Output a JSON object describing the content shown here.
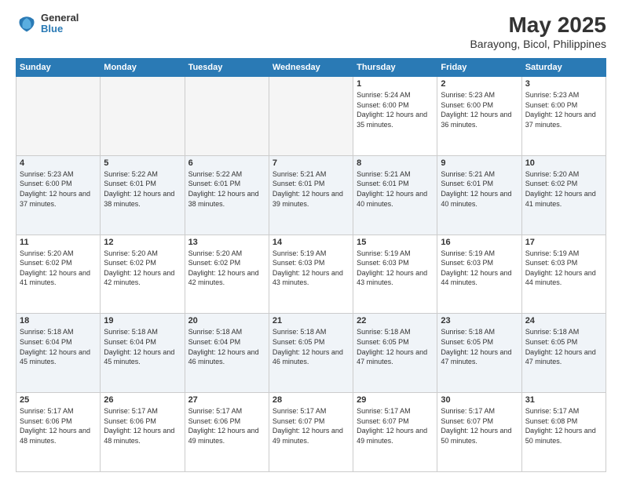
{
  "header": {
    "logo": {
      "line1": "General",
      "line2": "Blue"
    },
    "title": "May 2025",
    "subtitle": "Barayong, Bicol, Philippines"
  },
  "weekdays": [
    "Sunday",
    "Monday",
    "Tuesday",
    "Wednesday",
    "Thursday",
    "Friday",
    "Saturday"
  ],
  "weeks": [
    [
      {
        "day": "",
        "empty": true
      },
      {
        "day": "",
        "empty": true
      },
      {
        "day": "",
        "empty": true
      },
      {
        "day": "",
        "empty": true
      },
      {
        "day": "1",
        "rise": "5:24 AM",
        "set": "6:00 PM",
        "daylight": "12 hours and 35 minutes."
      },
      {
        "day": "2",
        "rise": "5:23 AM",
        "set": "6:00 PM",
        "daylight": "12 hours and 36 minutes."
      },
      {
        "day": "3",
        "rise": "5:23 AM",
        "set": "6:00 PM",
        "daylight": "12 hours and 37 minutes."
      }
    ],
    [
      {
        "day": "4",
        "rise": "5:23 AM",
        "set": "6:00 PM",
        "daylight": "12 hours and 37 minutes."
      },
      {
        "day": "5",
        "rise": "5:22 AM",
        "set": "6:01 PM",
        "daylight": "12 hours and 38 minutes."
      },
      {
        "day": "6",
        "rise": "5:22 AM",
        "set": "6:01 PM",
        "daylight": "12 hours and 38 minutes."
      },
      {
        "day": "7",
        "rise": "5:21 AM",
        "set": "6:01 PM",
        "daylight": "12 hours and 39 minutes."
      },
      {
        "day": "8",
        "rise": "5:21 AM",
        "set": "6:01 PM",
        "daylight": "12 hours and 40 minutes."
      },
      {
        "day": "9",
        "rise": "5:21 AM",
        "set": "6:01 PM",
        "daylight": "12 hours and 40 minutes."
      },
      {
        "day": "10",
        "rise": "5:20 AM",
        "set": "6:02 PM",
        "daylight": "12 hours and 41 minutes."
      }
    ],
    [
      {
        "day": "11",
        "rise": "5:20 AM",
        "set": "6:02 PM",
        "daylight": "12 hours and 41 minutes."
      },
      {
        "day": "12",
        "rise": "5:20 AM",
        "set": "6:02 PM",
        "daylight": "12 hours and 42 minutes."
      },
      {
        "day": "13",
        "rise": "5:20 AM",
        "set": "6:02 PM",
        "daylight": "12 hours and 42 minutes."
      },
      {
        "day": "14",
        "rise": "5:19 AM",
        "set": "6:03 PM",
        "daylight": "12 hours and 43 minutes."
      },
      {
        "day": "15",
        "rise": "5:19 AM",
        "set": "6:03 PM",
        "daylight": "12 hours and 43 minutes."
      },
      {
        "day": "16",
        "rise": "5:19 AM",
        "set": "6:03 PM",
        "daylight": "12 hours and 44 minutes."
      },
      {
        "day": "17",
        "rise": "5:19 AM",
        "set": "6:03 PM",
        "daylight": "12 hours and 44 minutes."
      }
    ],
    [
      {
        "day": "18",
        "rise": "5:18 AM",
        "set": "6:04 PM",
        "daylight": "12 hours and 45 minutes."
      },
      {
        "day": "19",
        "rise": "5:18 AM",
        "set": "6:04 PM",
        "daylight": "12 hours and 45 minutes."
      },
      {
        "day": "20",
        "rise": "5:18 AM",
        "set": "6:04 PM",
        "daylight": "12 hours and 46 minutes."
      },
      {
        "day": "21",
        "rise": "5:18 AM",
        "set": "6:05 PM",
        "daylight": "12 hours and 46 minutes."
      },
      {
        "day": "22",
        "rise": "5:18 AM",
        "set": "6:05 PM",
        "daylight": "12 hours and 47 minutes."
      },
      {
        "day": "23",
        "rise": "5:18 AM",
        "set": "6:05 PM",
        "daylight": "12 hours and 47 minutes."
      },
      {
        "day": "24",
        "rise": "5:18 AM",
        "set": "6:05 PM",
        "daylight": "12 hours and 47 minutes."
      }
    ],
    [
      {
        "day": "25",
        "rise": "5:17 AM",
        "set": "6:06 PM",
        "daylight": "12 hours and 48 minutes."
      },
      {
        "day": "26",
        "rise": "5:17 AM",
        "set": "6:06 PM",
        "daylight": "12 hours and 48 minutes."
      },
      {
        "day": "27",
        "rise": "5:17 AM",
        "set": "6:06 PM",
        "daylight": "12 hours and 49 minutes."
      },
      {
        "day": "28",
        "rise": "5:17 AM",
        "set": "6:07 PM",
        "daylight": "12 hours and 49 minutes."
      },
      {
        "day": "29",
        "rise": "5:17 AM",
        "set": "6:07 PM",
        "daylight": "12 hours and 49 minutes."
      },
      {
        "day": "30",
        "rise": "5:17 AM",
        "set": "6:07 PM",
        "daylight": "12 hours and 50 minutes."
      },
      {
        "day": "31",
        "rise": "5:17 AM",
        "set": "6:08 PM",
        "daylight": "12 hours and 50 minutes."
      }
    ]
  ],
  "labels": {
    "sunrise": "Sunrise:",
    "sunset": "Sunset:",
    "daylight": "Daylight:"
  }
}
